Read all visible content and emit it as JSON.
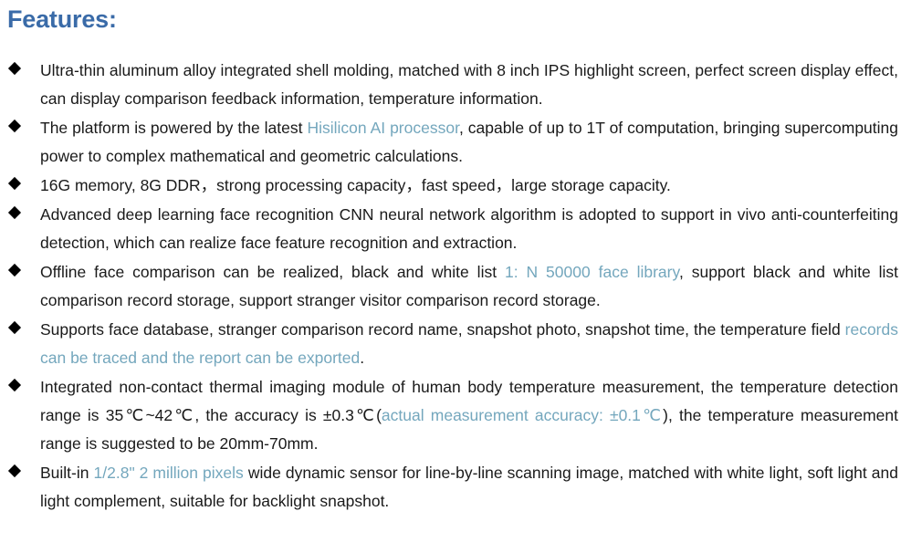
{
  "document": {
    "heading": "Features:",
    "heading_color": "#3a6ba8",
    "highlight_color": "#74a7bd",
    "body_color": "#1a1a1a",
    "bullet_glyph": "◆",
    "bullet_color": "#000000",
    "background_color": "#ffffff"
  },
  "bullets": [
    {
      "id": "ultra-thin-shell",
      "segments": [
        {
          "text": "Ultra-thin aluminum alloy integrated shell molding, matched with 8 inch IPS highlight screen, perfect screen display effect, can display comparison feedback information, temperature information.",
          "style": "normal"
        }
      ],
      "plain": "Ultra-thin aluminum alloy integrated shell molding, matched with 8 inch IPS highlight screen, perfect screen display effect, can display comparison feedback information, temperature information."
    },
    {
      "id": "hisilicon-platform",
      "segments": [
        {
          "text": "The platform is powered by the latest ",
          "style": "normal"
        },
        {
          "text": "Hisilicon AI processor",
          "style": "highlight"
        },
        {
          "text": ", capable of up to 1T of computation, bringing supercomputing power to complex mathematical and geometric calculations.",
          "style": "normal"
        }
      ],
      "plain": "The platform is powered by the latest Hisilicon AI processor, capable of up to 1T of computation, bringing supercomputing power to complex mathematical and geometric calculations."
    },
    {
      "id": "memory-spec",
      "segments": [
        {
          "text": "16G memory, 8G DDR，strong processing capacity，",
          "style": "normal"
        },
        {
          "text": "fast speed，",
          "style": "normal"
        },
        {
          "text": "large storage capacity.",
          "style": "normal"
        }
      ],
      "plain": "16G memory, 8G DDR，strong processing capacity， fast speed， large storage capacity."
    },
    {
      "id": "cnn-face-recognition",
      "segments": [
        {
          "text": "Advanced deep learning face recognition CNN neural network algorithm is adopted to support in vivo anti-counterfeiting detection, which can realize face feature recognition and extraction.",
          "style": "normal"
        }
      ],
      "plain": "Advanced deep learning face recognition CNN neural network algorithm is adopted to support in vivo anti-counterfeiting detection, which can realize face feature recognition and extraction."
    },
    {
      "id": "offline-face-comparison",
      "segments": [
        {
          "text": "Offline face comparison can be realized, black and white list ",
          "style": "normal"
        },
        {
          "text": "1: N 50000 face library",
          "style": "highlight"
        },
        {
          "text": ", support black and white list comparison record storage, support stranger visitor comparison record storage.",
          "style": "normal"
        }
      ],
      "plain": "Offline face comparison can be realized, black and white list 1: N 50000 face library, support black and white list comparison record storage, support stranger visitor comparison record storage."
    },
    {
      "id": "face-database-records",
      "segments": [
        {
          "text": "Supports face database, stranger comparison record name, snapshot photo, snapshot time, the temperature field ",
          "style": "normal"
        },
        {
          "text": "records can be traced and the report can be exported",
          "style": "highlight"
        },
        {
          "text": ".",
          "style": "normal"
        }
      ],
      "plain": "Supports face database, stranger comparison record name, snapshot photo, snapshot time, the temperature field records can be traced and the report can be exported."
    },
    {
      "id": "thermal-imaging-module",
      "segments": [
        {
          "text": "Integrated non-contact thermal imaging module of human body temperature measurement, the temperature detection range is 35℃~42℃, the accuracy is ±0.3℃(",
          "style": "normal"
        },
        {
          "text": "actual measurement accuracy: ±0.1℃",
          "style": "highlight"
        },
        {
          "text": "), the temperature measurement range is suggested to be 20mm-70mm.",
          "style": "normal"
        }
      ],
      "plain": "Integrated non-contact thermal imaging module of human body temperature measurement, the temperature detection range is 35℃~42℃, the accuracy is ±0.3℃(actual measurement accuracy: ±0.1℃), the temperature measurement range is suggested to be 20mm-70mm."
    },
    {
      "id": "built-in-sensor",
      "segments": [
        {
          "text": "Built-in ",
          "style": "normal"
        },
        {
          "text": "1/2.8\" 2 million pixels",
          "style": "highlight"
        },
        {
          "text": " wide dynamic sensor for line-by-line scanning image, matched with white light, soft light and light complement, suitable for backlight snapshot.",
          "style": "normal"
        }
      ],
      "plain": "Built-in 1/2.8\" 2 million pixels wide dynamic sensor for line-by-line scanning image, matched with white light, soft light and light complement, suitable for backlight snapshot."
    }
  ]
}
